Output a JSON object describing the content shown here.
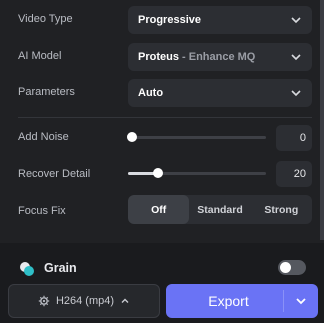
{
  "video_type": {
    "label": "Video Type",
    "value": "Progressive"
  },
  "ai_model": {
    "label": "AI Model",
    "value": "Proteus",
    "suffix": " - Enhance MQ"
  },
  "parameters": {
    "label": "Parameters",
    "value": "Auto"
  },
  "add_noise": {
    "label": "Add Noise",
    "value": "0",
    "level": 0.03
  },
  "recover_detail": {
    "label": "Recover Detail",
    "value": "20",
    "level": 0.22
  },
  "focus_fix": {
    "label": "Focus Fix",
    "options": [
      "Off",
      "Standard",
      "Strong"
    ],
    "selected": "Off"
  },
  "grain": {
    "label": "Grain",
    "enabled": false
  },
  "footer": {
    "codec_label": "H264 (mp4)",
    "export_label": "Export"
  },
  "colors": {
    "accent": "#6a73f5",
    "background": "#202124"
  }
}
